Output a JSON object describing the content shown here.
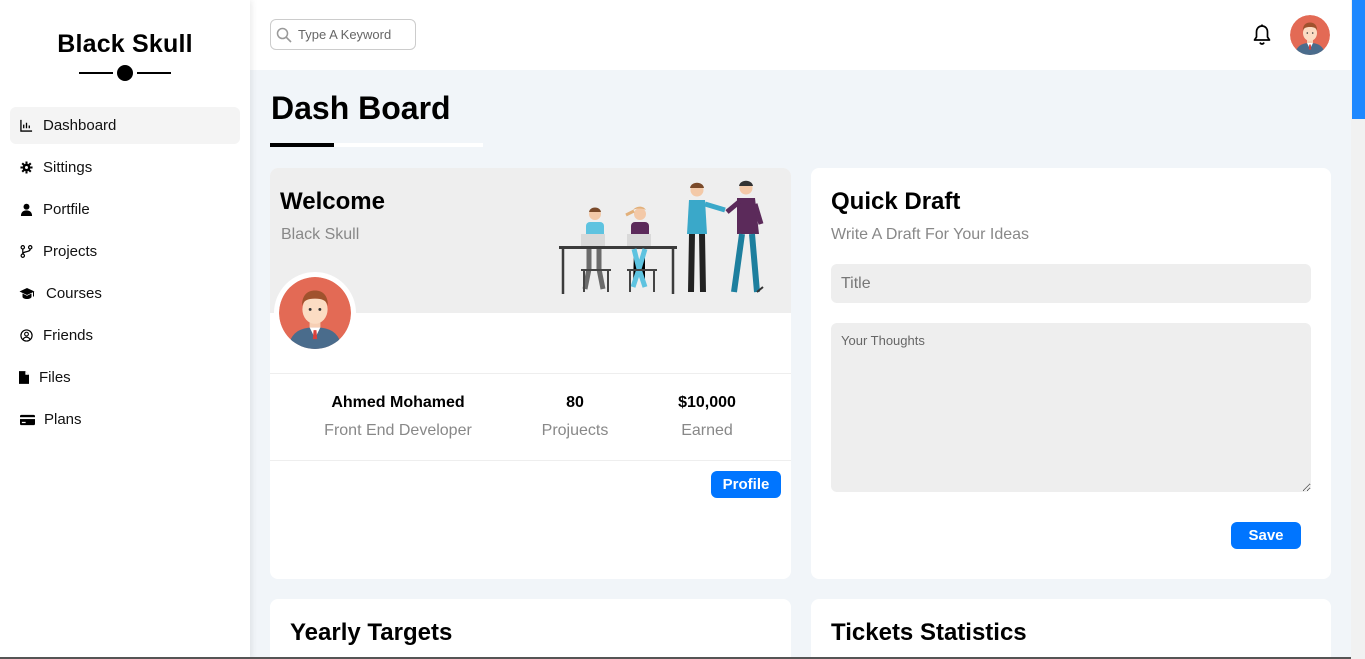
{
  "brand": {
    "name": "Black Skull"
  },
  "sidebar": {
    "items": [
      {
        "label": "Dashboard",
        "icon": "chart-icon",
        "active": true
      },
      {
        "label": "Sittings",
        "icon": "gear-icon"
      },
      {
        "label": "Portfile",
        "icon": "user-icon"
      },
      {
        "label": "Projects",
        "icon": "branch-icon"
      },
      {
        "label": "Courses",
        "icon": "graduation-cap-icon"
      },
      {
        "label": "Friends",
        "icon": "user-circle-icon"
      },
      {
        "label": "Files",
        "icon": "file-icon"
      },
      {
        "label": "Plans",
        "icon": "credit-card-icon"
      }
    ]
  },
  "topbar": {
    "search_placeholder": "Type A Keyword",
    "icons": [
      "search-icon",
      "bell-icon",
      "avatar"
    ]
  },
  "page": {
    "title": "Dash Board"
  },
  "welcome": {
    "title": "Welcome",
    "subtitle": "Black Skull",
    "name": "Ahmed Mohamed",
    "role": "Front End Developer",
    "projects_value": "80",
    "projects_label": "Projuects",
    "earned_value": "$10,000",
    "earned_label": "Earned",
    "button": "Profile"
  },
  "draft": {
    "title": "Quick Draft",
    "subtitle": "Write A Draft For Your Ideas",
    "title_placeholder": "Title",
    "body_placeholder": "Your Thoughts",
    "button": "Save"
  },
  "yearly": {
    "title": "Yearly Targets"
  },
  "tickets": {
    "title": "Tickets Statistics"
  },
  "colors": {
    "accent": "#0075ff",
    "background": "#f1f5f9",
    "avatar_bg": "#e36a55"
  }
}
